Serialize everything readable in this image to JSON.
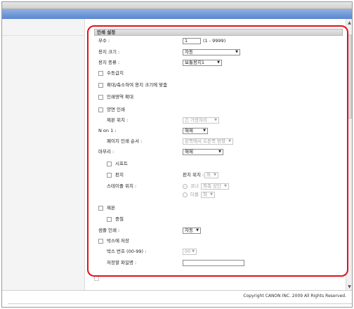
{
  "section_title": "인쇄 설정",
  "copies": {
    "label": "부수 :",
    "value": "1",
    "range": "(1 - 9999)"
  },
  "paper_size": {
    "label": "용지 크기 :",
    "value": "자동"
  },
  "paper_type": {
    "label": "용지 종류 :",
    "value": "보통용지1"
  },
  "manual_feed": {
    "label": "수동급지"
  },
  "fit_to_paper": {
    "label": "확대/축소하여 용지 크기에 맞춤"
  },
  "enlarge_print_area": {
    "label": "인쇄영역 확대"
  },
  "duplex": {
    "label": "양면 인쇄"
  },
  "binding_position": {
    "label": "제본 위치 :",
    "value": "긴 가장자리"
  },
  "n_on_1": {
    "label": "N on 1 :",
    "value": "해제"
  },
  "page_order": {
    "label": "페이지 인쇄 순서 :",
    "value": "왼쪽에서 오른쪽 방향"
  },
  "finishing": {
    "label": "마무리 :",
    "value": "해제"
  },
  "sort": {
    "label": "시프트"
  },
  "punch": {
    "label": "펀치",
    "position_label": "펀치 위치 :",
    "position_value": "좌"
  },
  "staple": {
    "label": "스테이플 위치 :",
    "corner_label": "코너",
    "corner_value": "좌측 상단",
    "double_label": "더블",
    "double_value": "좌"
  },
  "booklet": {
    "label": "제본"
  },
  "center_fold": {
    "label": "중철"
  },
  "out_print": {
    "label": "샘플 인쇄 :",
    "value": "자동"
  },
  "save_to_box": {
    "label": "박스에 저장"
  },
  "box_number": {
    "label": "박스 번호 (00-99) :",
    "value": "00"
  },
  "file_name": {
    "label": "저장할 파일명 :",
    "value": ""
  },
  "copyright": "Copyright CANON INC. 2009 All Rights Reserved.",
  "icons": {
    "scroll_up": "▲",
    "scroll_down": "▼",
    "dropdown": "▼"
  },
  "colors": {
    "highlight": "#e0101a",
    "bluebar": "#5a86cf"
  }
}
